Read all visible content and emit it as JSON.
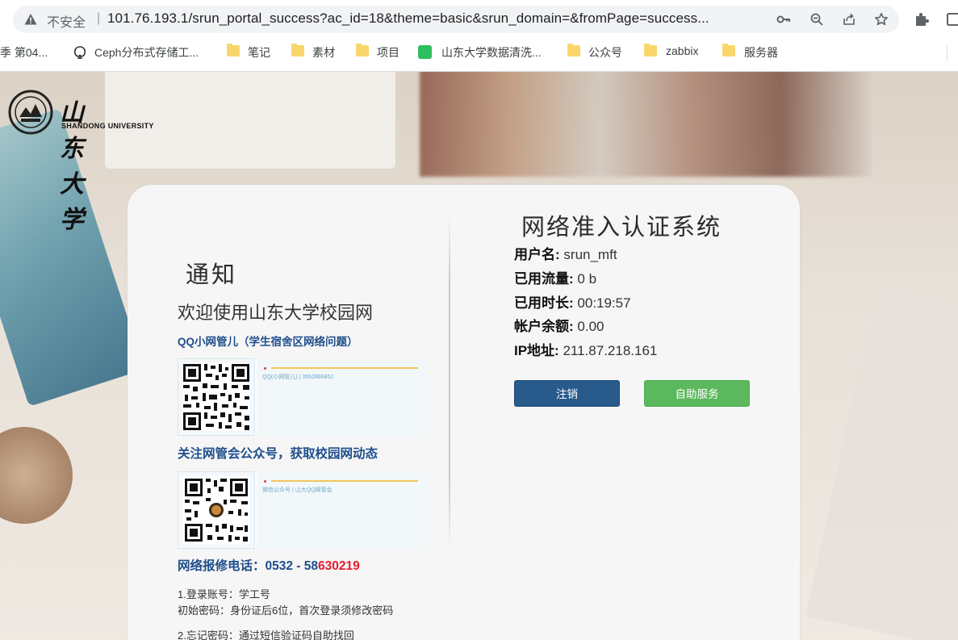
{
  "browser": {
    "security_label": "不安全",
    "separator": "|",
    "url": "101.76.193.1/srun_portal_success?ac_id=18&theme=basic&srun_domain=&fromPage=success...",
    "bookmarks": [
      {
        "label": "季 第04...",
        "icon": "partial"
      },
      {
        "label": "Ceph分布式存储工...",
        "icon": "logo"
      },
      {
        "label": "笔记",
        "icon": "folder-icon"
      },
      {
        "label": "素材",
        "icon": "folder-icon"
      },
      {
        "label": "项目",
        "icon": "folder-icon"
      },
      {
        "label": "山东大学数据清洗...",
        "icon": "evernote-icon"
      },
      {
        "label": "公众号",
        "icon": "folder-icon"
      },
      {
        "label": "zabbix",
        "icon": "folder-icon"
      },
      {
        "label": "服务器",
        "icon": "folder-icon"
      }
    ]
  },
  "logo": {
    "cn": "山东大学",
    "en": "SHANDONG UNIVERSITY"
  },
  "notice": {
    "title": "通知",
    "welcome": "欢迎使用山东大学校园网",
    "qq_title": "QQ小网管儿（学生宿舍区网络问题）",
    "qq_caption": "QQ(小网管儿) | 3552866852",
    "follow_title": "关注网管会公众号，获取校园网动态",
    "wechat_caption": "微信公众号 | 山大QQ网管会",
    "phone_label": "网络报修电话：",
    "phone_prefix": "0532 - 58",
    "phone_suffix": "630219",
    "instructions": [
      "1.登录账号：学工号",
      "初始密码：身份证后6位，首次登录须修改密码",
      "2.忘记密码：通过短信验证码自助找回"
    ]
  },
  "system": {
    "title": "网络准入认证系统",
    "rows": [
      {
        "label": "用户名:",
        "value": "srun_mft"
      },
      {
        "label": "已用流量:",
        "value": "0 b"
      },
      {
        "label": "已用时长:",
        "value": "00:19:57"
      },
      {
        "label": "帐户余额:",
        "value": "0.00"
      },
      {
        "label": "IP地址:",
        "value": "211.87.218.161"
      }
    ],
    "logout_label": "注销",
    "self_service_label": "自助服务"
  },
  "colors": {
    "primary_button": "#285a8c",
    "success_button": "#5cb85c",
    "accent_blue_text": "#1f4e8c",
    "phone_red": "#e8192c"
  }
}
